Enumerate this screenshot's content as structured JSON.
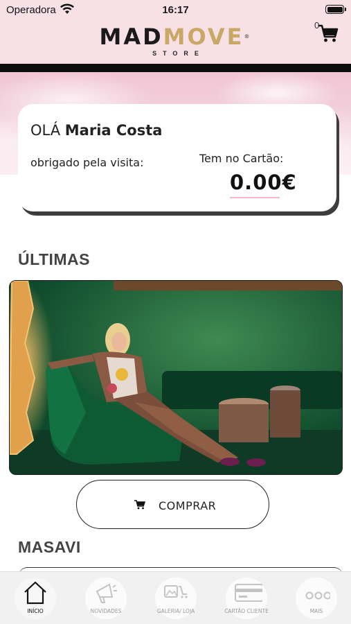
{
  "status_bar": {
    "carrier": "Operadora",
    "time": "16:17"
  },
  "header": {
    "logo_left": "MAD",
    "logo_right": "MOVE",
    "logo_sub": "STORE",
    "cart_count": "0"
  },
  "greeting": {
    "hello_prefix": "OLÁ",
    "user_name": "Maria Costa",
    "thanks_text": "obrigado pela visita:",
    "card_label": "Tem no Cartão:",
    "balance": "0.00€"
  },
  "sections": [
    {
      "title": "ÚLTIMAS"
    },
    {
      "title": "MASAVI"
    }
  ],
  "product": {
    "buy_label": "COMPRAR"
  },
  "tabbar": {
    "items": [
      {
        "label": "INÍCIO",
        "icon": "home-icon",
        "active": true
      },
      {
        "label": "NOVIDADES",
        "icon": "megaphone-icon",
        "active": false
      },
      {
        "label": "GALERIA/ LOJA",
        "icon": "gallery-cart-icon",
        "active": false
      },
      {
        "label": "CARTÃO CLIENTE",
        "icon": "credit-card-icon",
        "active": false
      },
      {
        "label": "MAIS",
        "icon": "more-dots-icon",
        "active": false
      }
    ]
  },
  "colors": {
    "header_bg": "#f7e1e7",
    "brand_gold": "#c9a866",
    "header_rule": "#0d0d0d"
  }
}
